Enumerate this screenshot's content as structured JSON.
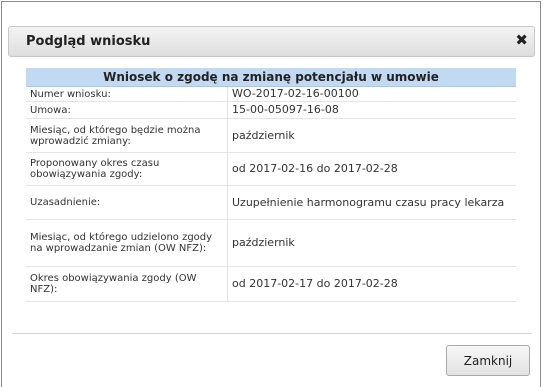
{
  "dialog": {
    "title": "Podgląd wniosku",
    "close_glyph": "✖",
    "close_icon": "close-icon"
  },
  "table": {
    "heading": "Wniosek o zgodę na zmianę potencjału w umowie",
    "rows": [
      {
        "label": "Numer wniosku:",
        "value": "WO-2017-02-16-00100"
      },
      {
        "label": "Umowa:",
        "value": "15-00-05097-16-08"
      },
      {
        "label": "Miesiąc, od którego będzie można wprowadzić zmiany:",
        "value": "październik"
      },
      {
        "label": "Proponowany okres czasu obowiązywania zgody:",
        "value": "od 2017-02-16 do 2017-02-28"
      },
      {
        "label": "Uzasadnienie:",
        "value": "Uzupełnienie harmonogramu czasu pracy lekarza"
      },
      {
        "label": "Miesiąc, od którego udzielono zgody na wprowadzanie zmian (OW NFZ):",
        "value": "październik"
      },
      {
        "label": "Okres obowiązywania zgody (OW NFZ):",
        "value": "od 2017-02-17 do 2017-02-28"
      }
    ]
  },
  "footer": {
    "close_button_label": "Zamknij"
  }
}
